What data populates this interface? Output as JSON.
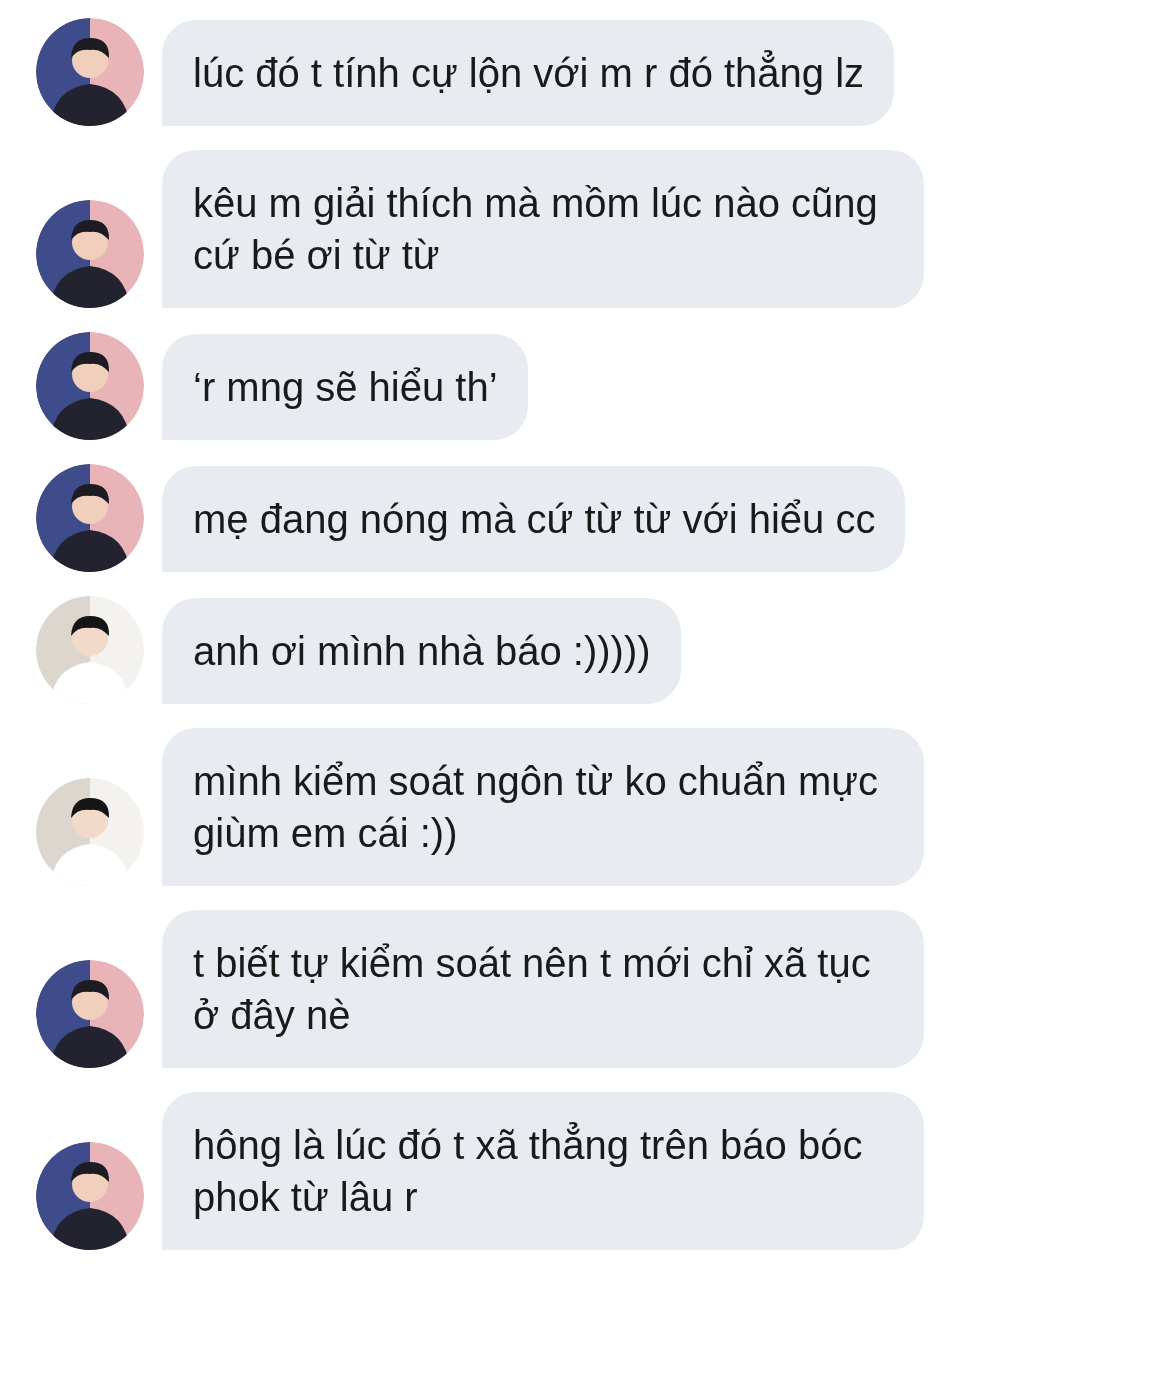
{
  "messages": [
    {
      "kind": "host",
      "text": "lúc đó t tính cự lộn với m r đó thẳng lz"
    },
    {
      "kind": "host",
      "text": "kêu m giải thích mà mồm lúc nào cũng cứ bé ơi từ từ"
    },
    {
      "kind": "host",
      "text": "‘r mng sẽ hiểu th’"
    },
    {
      "kind": "host",
      "text": "mẹ đang nóng mà cứ từ từ với hiểu cc"
    },
    {
      "kind": "guest",
      "text": "anh ơi mình nhà báo :)))))"
    },
    {
      "kind": "guest",
      "text": "mình kiểm soát ngôn từ ko chuẩn mực giùm em cái :))"
    },
    {
      "kind": "host",
      "text": "t biết tự kiểm soát nên t mới chỉ xã tục ở đây nè"
    },
    {
      "kind": "host",
      "text": "hông là lúc đó t xã thẳng trên báo bóc phok từ lâu r"
    }
  ]
}
